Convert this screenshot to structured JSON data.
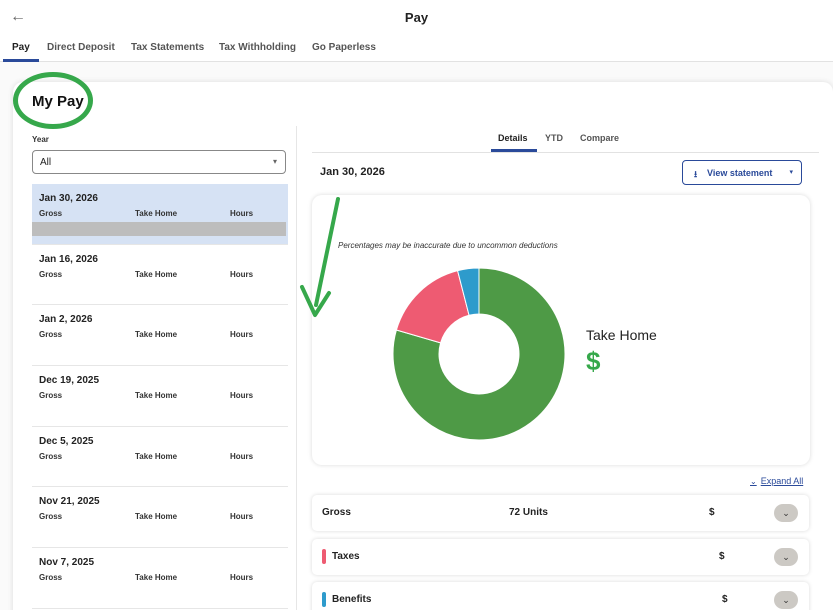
{
  "header": {
    "back_icon": "←",
    "title": "Pay"
  },
  "tabs": [
    {
      "label": "Pay"
    },
    {
      "label": "Direct Deposit"
    },
    {
      "label": "Tax Statements"
    },
    {
      "label": "Tax Withholding"
    },
    {
      "label": "Go Paperless"
    }
  ],
  "accent_color": "#2a4a9a",
  "highlight_color": "#36a84b",
  "mypay": {
    "title": "My Pay",
    "year_label": "Year",
    "year_value": "All",
    "caret": "▾"
  },
  "paychecks": [
    {
      "date": "Jan 30, 2026"
    },
    {
      "date": "Jan 16, 2026"
    },
    {
      "date": "Jan 2, 2026"
    },
    {
      "date": "Dec 19, 2025"
    },
    {
      "date": "Dec 5, 2025"
    },
    {
      "date": "Nov 21, 2025"
    },
    {
      "date": "Nov 7, 2025"
    }
  ],
  "paycheck_columns": {
    "gross": "Gross",
    "take_home": "Take Home",
    "hours": "Hours"
  },
  "detail_tabs": [
    {
      "label": "Details"
    },
    {
      "label": "YTD"
    },
    {
      "label": "Compare"
    }
  ],
  "detail": {
    "date": "Jan 30, 2026",
    "view_statement": "View statement",
    "download_icon": "⭳",
    "caret": "▾",
    "note": "Percentages may be inaccurate due to uncommon deductions",
    "take_home_label": "Take Home",
    "take_home_value": "$",
    "expand_all": "Expand All",
    "expand_chevron": "⌄"
  },
  "breakdown_chart": {
    "type": "donut",
    "segments": [
      {
        "name": "Take Home",
        "fraction": 0.795,
        "color": "#4e9a46"
      },
      {
        "name": "Taxes",
        "fraction": 0.165,
        "color": "#ee5b72"
      },
      {
        "name": "Benefits",
        "fraction": 0.04,
        "color": "#2e9bcc"
      }
    ]
  },
  "rows": [
    {
      "label": "Gross",
      "units": "72 Units",
      "value": "$",
      "chevron": "⌄",
      "color": ""
    },
    {
      "label": "Taxes",
      "units": "",
      "value": "$",
      "chevron": "⌄",
      "color": "#ee5b72"
    },
    {
      "label": "Benefits",
      "units": "",
      "value": "$",
      "chevron": "⌄",
      "color": "#2e9bcc"
    }
  ]
}
